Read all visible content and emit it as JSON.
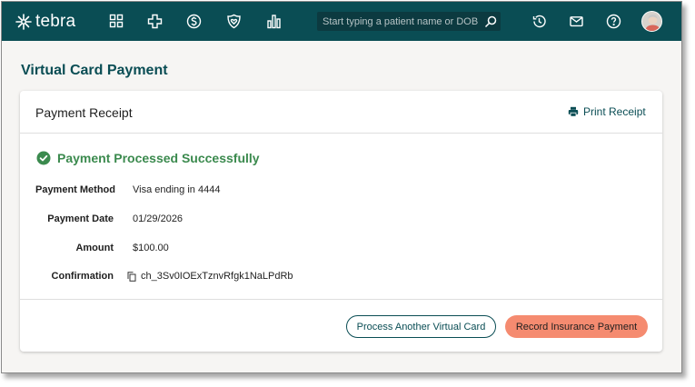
{
  "brand": {
    "name": "tebra"
  },
  "nav": {
    "icons": [
      "grid-icon",
      "medical-cross-icon",
      "dollar-icon",
      "heart-badge-icon",
      "bar-chart-icon"
    ]
  },
  "search": {
    "placeholder": "Start typing a patient name or DOB"
  },
  "header_right": {
    "icons": [
      "history-icon",
      "mail-icon",
      "help-icon"
    ]
  },
  "page": {
    "title": "Virtual Card Payment"
  },
  "card": {
    "title": "Payment Receipt",
    "print_label": "Print Receipt",
    "status": "Payment Processed Successfully",
    "details": [
      {
        "label": "Payment Method",
        "value": "Visa ending in 4444"
      },
      {
        "label": "Payment Date",
        "value": "01/29/2026"
      },
      {
        "label": "Amount",
        "value": "$100.00"
      },
      {
        "label": "Confirmation",
        "value": "ch_3Sv0IOExTznvRfgk1NaLPdRb"
      }
    ],
    "buttons": {
      "secondary": "Process Another Virtual Card",
      "primary": "Record Insurance Payment"
    }
  },
  "colors": {
    "topbar": "#0a4d54",
    "success": "#3b8a4e",
    "primary_button": "#f58b70",
    "background": "#f6f5f3"
  }
}
